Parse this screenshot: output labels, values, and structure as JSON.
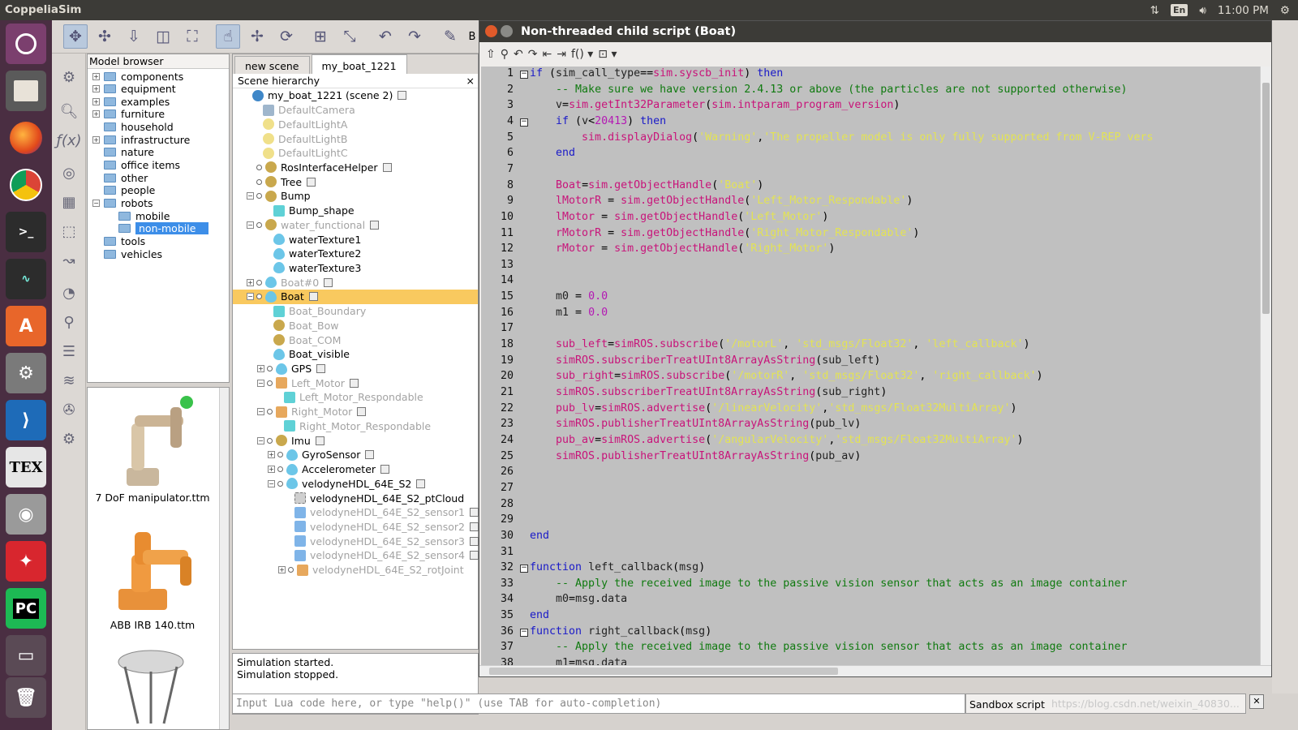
{
  "topbar": {
    "app_name": "CoppeliaSim",
    "keyboard": "En",
    "time": "11:00 PM"
  },
  "launcher": {
    "items": [
      "Ubuntu",
      "Files",
      "Firefox",
      "Chrome",
      "Terminal",
      "System Monitor",
      "Software",
      "Settings",
      "VS Code",
      "TeX",
      "Camera",
      "Dance",
      "PyCharm",
      "Workspaces",
      "Trash"
    ]
  },
  "toolbar": {
    "partial_label": "B"
  },
  "model_browser": {
    "title": "Model browser",
    "items": [
      {
        "label": "components",
        "expandable": true
      },
      {
        "label": "equipment",
        "expandable": true
      },
      {
        "label": "examples",
        "expandable": true
      },
      {
        "label": "furniture",
        "expandable": true
      },
      {
        "label": "household",
        "expandable": false
      },
      {
        "label": "infrastructure",
        "expandable": true
      },
      {
        "label": "nature",
        "expandable": false
      },
      {
        "label": "office items",
        "expandable": false
      },
      {
        "label": "other",
        "expandable": false
      },
      {
        "label": "people",
        "expandable": false
      },
      {
        "label": "robots",
        "expandable": true
      },
      {
        "label": "mobile",
        "expandable": false
      },
      {
        "label": "non-mobile",
        "expandable": false
      },
      {
        "label": "tools",
        "expandable": false
      },
      {
        "label": "vehicles",
        "expandable": false
      }
    ],
    "thumbnails": [
      "7 DoF manipulator.ttm",
      "ABB IRB 140.ttm"
    ]
  },
  "scene": {
    "tabs": [
      "new scene",
      "my_boat_1221"
    ],
    "hierarchy_title": "Scene hierarchy",
    "close": "×",
    "rows": [
      {
        "label": "my_boat_1221 (scene 2)",
        "icon": "globe-icon",
        "dim": false
      },
      {
        "label": "DefaultCamera",
        "icon": "camera-icon",
        "dim": true
      },
      {
        "label": "DefaultLightA",
        "icon": "light-icon",
        "dim": true
      },
      {
        "label": "DefaultLightB",
        "icon": "light-icon",
        "dim": true
      },
      {
        "label": "DefaultLightC",
        "icon": "light-icon",
        "dim": true
      },
      {
        "label": "RosInterfaceHelper",
        "icon": "dummy-icon",
        "dim": false
      },
      {
        "label": "Tree",
        "icon": "dummy-icon",
        "dim": false
      },
      {
        "label": "Bump",
        "icon": "dummy-icon",
        "dim": false
      },
      {
        "label": "Bump_shape",
        "icon": "shape-icon",
        "dim": false
      },
      {
        "label": "water_functional",
        "icon": "dummy-icon",
        "dim": true
      },
      {
        "label": "waterTexture1",
        "icon": "drop-icon",
        "dim": false
      },
      {
        "label": "waterTexture2",
        "icon": "drop-icon",
        "dim": false
      },
      {
        "label": "waterTexture3",
        "icon": "drop-icon",
        "dim": false
      },
      {
        "label": "Boat#0",
        "icon": "drop-icon",
        "dim": true
      },
      {
        "label": "Boat",
        "icon": "drop-icon",
        "dim": false
      },
      {
        "label": "Boat_Boundary",
        "icon": "shape-icon",
        "dim": true
      },
      {
        "label": "Boat_Bow",
        "icon": "dummy-icon",
        "dim": true
      },
      {
        "label": "Boat_COM",
        "icon": "dummy-icon",
        "dim": true
      },
      {
        "label": "Boat_visible",
        "icon": "drop-icon",
        "dim": false
      },
      {
        "label": "GPS",
        "icon": "drop-icon",
        "dim": false
      },
      {
        "label": "Left_Motor",
        "icon": "joint-icon",
        "dim": true
      },
      {
        "label": "Left_Motor_Respondable",
        "icon": "shape-icon",
        "dim": true
      },
      {
        "label": "Right_Motor",
        "icon": "joint-icon",
        "dim": true
      },
      {
        "label": "Right_Motor_Respondable",
        "icon": "shape-icon",
        "dim": true
      },
      {
        "label": "Imu",
        "icon": "dummy-icon",
        "dim": false
      },
      {
        "label": "GyroSensor",
        "icon": "drop-icon",
        "dim": false
      },
      {
        "label": "Accelerometer",
        "icon": "drop-icon",
        "dim": false
      },
      {
        "label": "velodyneHDL_64E_S2",
        "icon": "drop-icon",
        "dim": false
      },
      {
        "label": "velodyneHDL_64E_S2_ptCloud",
        "icon": "pointcloud-icon",
        "dim": false
      },
      {
        "label": "velodyneHDL_64E_S2_sensor1",
        "icon": "vision-sensor-icon",
        "dim": true
      },
      {
        "label": "velodyneHDL_64E_S2_sensor2",
        "icon": "vision-sensor-icon",
        "dim": true
      },
      {
        "label": "velodyneHDL_64E_S2_sensor3",
        "icon": "vision-sensor-icon",
        "dim": true
      },
      {
        "label": "velodyneHDL_64E_S2_sensor4",
        "icon": "vision-sensor-icon",
        "dim": true
      },
      {
        "label": "velodyneHDL_64E_S2_rotJoint",
        "icon": "joint-icon",
        "dim": true
      }
    ]
  },
  "status": {
    "lines": [
      "Simulation started.",
      "Simulation stopped."
    ]
  },
  "lua_input": {
    "placeholder": "Input Lua code here, or type \"help()\" (use TAB for auto-completion)"
  },
  "sandbox": {
    "label": "Sandbox script",
    "watermark": "https://blog.csdn.net/weixin_40830..."
  },
  "editor": {
    "title": "Non-threaded child script (Boat)",
    "func_menu": "f()",
    "lines": [
      "if (sim_call_type==sim.syscb_init) then",
      "    -- Make sure we have version 2.4.13 or above (the particles are not supported otherwise)",
      "    v=sim.getInt32Parameter(sim.intparam_program_version)",
      "    if (v<20413) then",
      "        sim.displayDialog('Warning','The propeller model is only fully supported from V-REP vers",
      "    end",
      "",
      "    Boat=sim.getObjectHandle('Boat')",
      "    lMotorR = sim.getObjectHandle('Left_Motor_Respondable')",
      "    lMotor = sim.getObjectHandle('Left_Motor')",
      "    rMotorR = sim.getObjectHandle('Right_Motor_Respondable')",
      "    rMotor = sim.getObjectHandle('Right_Motor')",
      "",
      "",
      "    m0 = 0.0",
      "    m1 = 0.0",
      "",
      "    sub_left=simROS.subscribe('/motorL', 'std_msgs/Float32', 'left_callback')",
      "    simROS.subscriberTreatUInt8ArrayAsString(sub_left)",
      "    sub_right=simROS.subscribe('/motorR', 'std_msgs/Float32', 'right_callback')",
      "    simROS.subscriberTreatUInt8ArrayAsString(sub_right)",
      "    pub_lv=simROS.advertise('/linearVelocity','std_msgs/Float32MultiArray')",
      "    simROS.publisherTreatUInt8ArrayAsString(pub_lv)",
      "    pub_av=simROS.advertise('/angularVelocity','std_msgs/Float32MultiArray')",
      "    simROS.publisherTreatUInt8ArrayAsString(pub_av)",
      "",
      "",
      "",
      "",
      "end",
      "",
      "function left_callback(msg)",
      "    -- Apply the received image to the passive vision sensor that acts as an image container",
      "    m0=msg.data",
      "end",
      "function right_callback(msg)",
      "    -- Apply the received image to the passive vision sensor that acts as an image container",
      "    m1=msg.data"
    ]
  }
}
